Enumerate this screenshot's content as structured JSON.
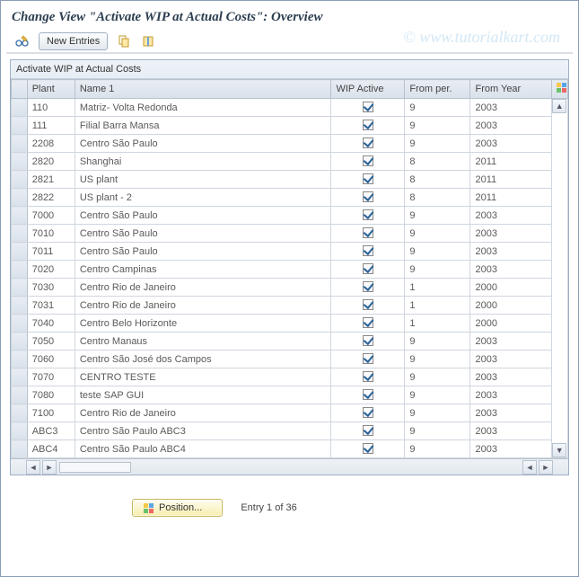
{
  "title": "Change View \"Activate WIP at Actual Costs\": Overview",
  "watermark": "© www.tutorialkart.com",
  "toolbar": {
    "new_entries_label": "New Entries"
  },
  "panel": {
    "title": "Activate WIP at Actual Costs"
  },
  "columns": {
    "plant": "Plant",
    "name": "Name 1",
    "wip": "WIP Active",
    "from_per": "From per.",
    "from_year": "From Year"
  },
  "rows": [
    {
      "plant": "110",
      "name": "Matriz- Volta Redonda",
      "wip": true,
      "from_per": "9",
      "from_year": "2003"
    },
    {
      "plant": "111",
      "name": "Filial Barra Mansa",
      "wip": true,
      "from_per": "9",
      "from_year": "2003"
    },
    {
      "plant": "2208",
      "name": "Centro São Paulo",
      "wip": true,
      "from_per": "9",
      "from_year": "2003"
    },
    {
      "plant": "2820",
      "name": "Shanghai",
      "wip": true,
      "from_per": "8",
      "from_year": "2011"
    },
    {
      "plant": "2821",
      "name": "US plant",
      "wip": true,
      "from_per": "8",
      "from_year": "2011"
    },
    {
      "plant": "2822",
      "name": "US plant - 2",
      "wip": true,
      "from_per": "8",
      "from_year": "2011"
    },
    {
      "plant": "7000",
      "name": "Centro São Paulo",
      "wip": true,
      "from_per": "9",
      "from_year": "2003"
    },
    {
      "plant": "7010",
      "name": "Centro São Paulo",
      "wip": true,
      "from_per": "9",
      "from_year": "2003"
    },
    {
      "plant": "7011",
      "name": "Centro São Paulo",
      "wip": true,
      "from_per": "9",
      "from_year": "2003"
    },
    {
      "plant": "7020",
      "name": "Centro Campinas",
      "wip": true,
      "from_per": "9",
      "from_year": "2003"
    },
    {
      "plant": "7030",
      "name": "Centro Rio de Janeiro",
      "wip": true,
      "from_per": "1",
      "from_year": "2000"
    },
    {
      "plant": "7031",
      "name": "Centro Rio de Janeiro",
      "wip": true,
      "from_per": "1",
      "from_year": "2000"
    },
    {
      "plant": "7040",
      "name": "Centro Belo Horizonte",
      "wip": true,
      "from_per": "1",
      "from_year": "2000"
    },
    {
      "plant": "7050",
      "name": "Centro Manaus",
      "wip": true,
      "from_per": "9",
      "from_year": "2003"
    },
    {
      "plant": "7060",
      "name": "Centro São José dos Campos",
      "wip": true,
      "from_per": "9",
      "from_year": "2003"
    },
    {
      "plant": "7070",
      "name": "CENTRO TESTE",
      "wip": true,
      "from_per": "9",
      "from_year": "2003"
    },
    {
      "plant": "7080",
      "name": "teste SAP GUI",
      "wip": true,
      "from_per": "9",
      "from_year": "2003"
    },
    {
      "plant": "7100",
      "name": "Centro Rio de Janeiro",
      "wip": true,
      "from_per": "9",
      "from_year": "2003"
    },
    {
      "plant": "ABC3",
      "name": "Centro São Paulo ABC3",
      "wip": true,
      "from_per": "9",
      "from_year": "2003"
    },
    {
      "plant": "ABC4",
      "name": "Centro São Paulo ABC4",
      "wip": true,
      "from_per": "9",
      "from_year": "2003"
    }
  ],
  "footer": {
    "position_label": "Position...",
    "entry_text": "Entry 1 of 36"
  }
}
